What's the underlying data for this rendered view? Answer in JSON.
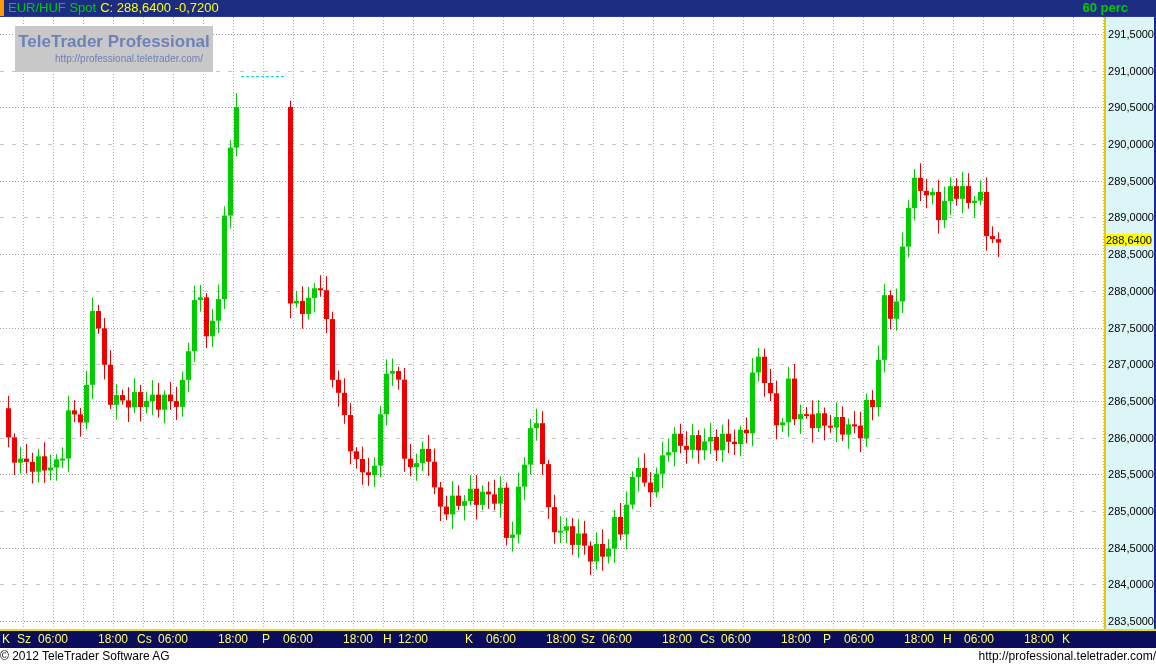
{
  "header": {
    "instrument": "EUR/HUF Spot",
    "quote": "C: 288,6400 -0,7200",
    "interval": "60 perc"
  },
  "logo": {
    "title": "TeleTrader Professional",
    "url": "http://professional.teletrader.com/"
  },
  "y_axis": [
    "291,5000",
    "291,0000",
    "290,5000",
    "290,0000",
    "289,5000",
    "289,0000",
    "288,5000",
    "288,0000",
    "287,5000",
    "287,0000",
    "286,5000",
    "286,0000",
    "285,5000",
    "285,0000",
    "284,5000",
    "284,0000",
    "283,5000"
  ],
  "current_price": "288,6400",
  "x_axis": [
    {
      "day": "K"
    },
    {
      "day": "Sz",
      "times": [
        "06:00",
        "18:00"
      ]
    },
    {
      "day": "Cs",
      "times": [
        "06:00",
        "18:00"
      ]
    },
    {
      "day": "P",
      "times": [
        "06:00",
        "18:00"
      ]
    },
    {
      "day": "H",
      "times": [
        "12:00"
      ]
    },
    {
      "day": "K",
      "times": [
        "06:00",
        "18:00"
      ]
    },
    {
      "day": "Sz",
      "times": [
        "06:00",
        "18:00"
      ]
    },
    {
      "day": "Cs",
      "times": [
        "06:00",
        "18:00"
      ]
    },
    {
      "day": "P",
      "times": [
        "06:00",
        "18:00"
      ]
    },
    {
      "day": "H",
      "times": [
        "06:00",
        "18:00"
      ]
    },
    {
      "day": "K"
    }
  ],
  "footer": {
    "copyright": "© 2012 TeleTrader Software AG",
    "url": "http://professional.teletrader.com/"
  }
}
